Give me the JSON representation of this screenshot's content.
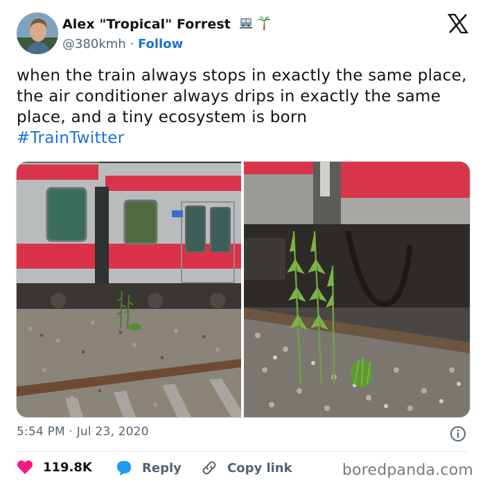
{
  "tweet": {
    "display_name": "Alex \"Tropical\" Forrest",
    "name_emojis": [
      "train-station-icon",
      "palm-tree-icon"
    ],
    "handle": "@380kmh",
    "separator": "·",
    "follow_label": "Follow",
    "text": "when the train always stops in exactly the same place, the air conditioner always drips in exactly the same place, and a tiny ecosystem is born",
    "hashtag": "#TrainTwitter",
    "timestamp": "5:54 PM · Jul 23, 2020",
    "likes": "119.8K",
    "reply_label": "Reply",
    "copy_link_label": "Copy link"
  },
  "watermark": "boredpanda.com",
  "colors": {
    "link_blue": "#1a73d9",
    "like_red": "#f91880",
    "reply_blue": "#1d9bf0",
    "muted": "#536471"
  }
}
